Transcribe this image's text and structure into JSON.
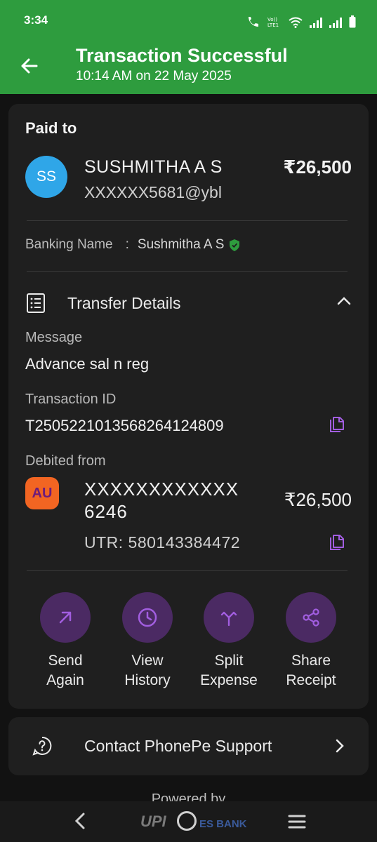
{
  "status_bar": {
    "time": "3:34"
  },
  "header": {
    "title": "Transaction Successful",
    "subtitle": "10:14 AM on 22 May 2025",
    "bg_color": "#2e9c3e"
  },
  "paid_to": {
    "label": "Paid to",
    "avatar_initials": "SS",
    "name": "SUSHMITHA A S",
    "upi_id": "XXXXXX5681@ybl",
    "amount": "₹26,500"
  },
  "banking": {
    "label": "Banking Name",
    "separator": ":",
    "name": "Sushmitha A S"
  },
  "transfer_details": {
    "heading": "Transfer Details",
    "message_label": "Message",
    "message_value": "Advance sal n reg",
    "txn_label": "Transaction ID",
    "txn_value": "T2505221013568264124809",
    "debited_label": "Debited from",
    "bank_logo_text": "AU",
    "account_line1": "XXXXXXXXXXXX",
    "account_line2": "6246",
    "debited_amount": "₹26,500",
    "utr": "UTR: 580143384472"
  },
  "actions": [
    {
      "line1": "Send",
      "line2": "Again",
      "icon": "arrow-up-right-icon"
    },
    {
      "line1": "View",
      "line2": "History",
      "icon": "clock-icon"
    },
    {
      "line1": "Split",
      "line2": "Expense",
      "icon": "split-icon"
    },
    {
      "line1": "Share",
      "line2": "Receipt",
      "icon": "share-icon"
    }
  ],
  "support": {
    "label": "Contact PhonePe Support"
  },
  "footer": {
    "powered_by": "Powered by",
    "upi_text": "UPI",
    "bank_text": "ES BANK"
  },
  "colors": {
    "accent_purple": "#4b2a63",
    "icon_purple": "#a25ee0",
    "verified_green": "#2e9c3e"
  }
}
